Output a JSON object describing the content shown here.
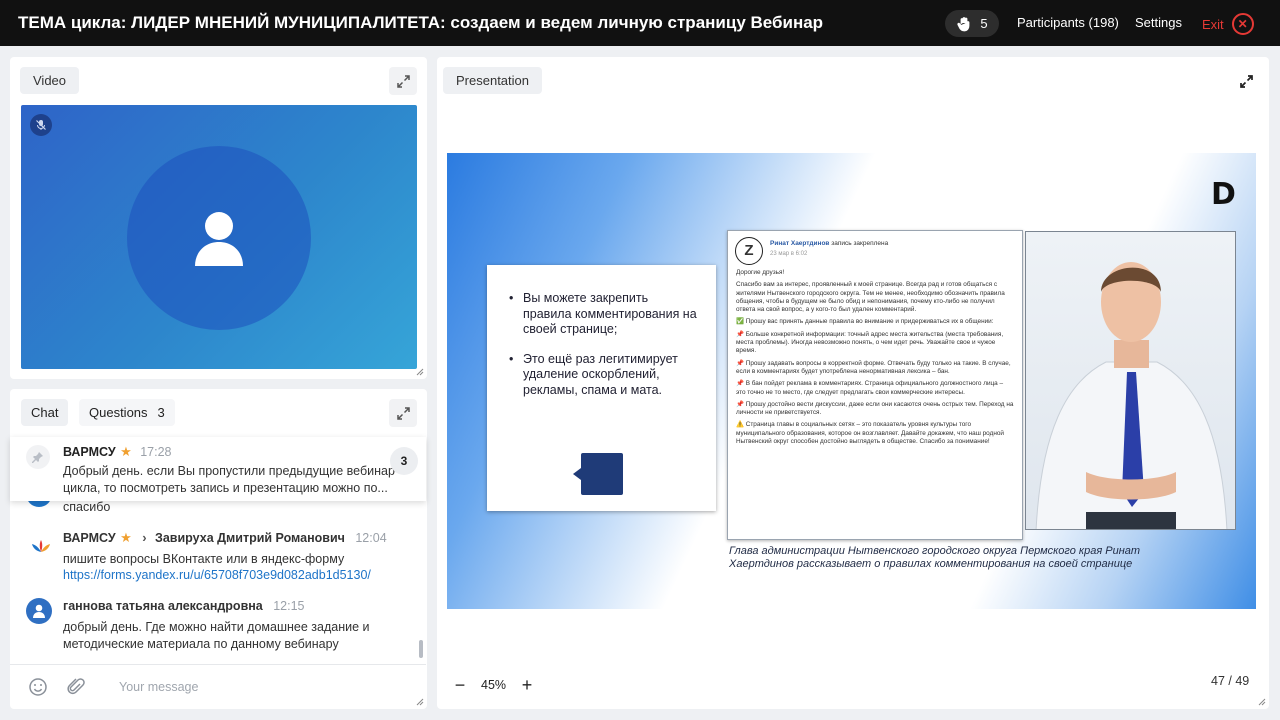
{
  "header": {
    "title": "ТЕМА цикла: ЛИДЕР МНЕНИЙ МУНИЦИПАЛИТЕТА: создаем и ведем личную страницу Вебинар",
    "raised_hands": "5",
    "participants": "Participants (198)",
    "settings": "Settings",
    "exit": "Exit"
  },
  "video": {
    "label": "Video"
  },
  "chat": {
    "tab_chat": "Chat",
    "tab_questions": "Questions",
    "questions_count": "3",
    "pinned": {
      "name": "ВАРМСУ",
      "star": "★",
      "time": "17:28",
      "line1": "Добрый день. если Вы пропустили предыдущие вебинар",
      "line2": "цикла, то посмотреть запись и презентацию можно по...",
      "badge": "3"
    },
    "messages": [
      {
        "text": "спасибо"
      },
      {
        "name": "ВАРМСУ",
        "star": "★",
        "arrow": "›",
        "to": "Завируха Дмитрий Романович",
        "time": "12:04",
        "line1": "пишите вопросы ВКонтакте или в яндекс-форму",
        "link": "https://forms.yandex.ru/u/65708f703e9d082adb1d5130/"
      },
      {
        "name": "ганнова татьяна александровна",
        "time": "12:15",
        "line1": "добрый день. Где можно найти домашнее задание и",
        "line2": "методические материала по данному вебинару"
      }
    ],
    "input_placeholder": "Your message"
  },
  "presentation": {
    "label": "Presentation",
    "zoom": "45%",
    "zoom_minus": "−",
    "zoom_plus": "+",
    "page": "47 / 49",
    "slide": {
      "logo": "D",
      "bullets": [
        "Вы можете закрепить правила комментирования на своей странице;",
        "Это ещё раз легитимирует удаление оскорблений, рекламы, спама и мата."
      ],
      "post_logo": "Z",
      "post_author": "Ринат Хаертдинов",
      "post_pinned": "запись закреплена",
      "post_date": "23 мар в 6:02",
      "post_paragraphs": [
        "Дорогие друзья!",
        "Спасибо вам за интерес, проявленный к моей странице. Всегда рад и готов общаться с жителями Нытвенского городского округа. Тем не менее, необходимо обозначить правила общения, чтобы в будущем не было обид и непонимания, почему кто-либо не получил ответа на свой вопрос, а у кого-то был удален комментарий.",
        "✅ Прошу вас принять данные правила во внимание и придерживаться их в общении:",
        "📌 Больше конкретной информации: точный адрес места жительства (места требования, места проблемы). Иногда невозможно понять, о чем идет речь. Уважайте свое и чужое время.",
        "📌 Прошу задавать вопросы в корректной форме. Отвечать буду только на такие. В случае, если в комментариях будет употреблена ненормативная лексика – бан.",
        "📌 В бан пойдет реклама в комментариях. Страница официального должностного лица – это точно не то место, где следует предлагать свои коммерческие интересы.",
        "📌 Прошу достойно вести дискуссии, даже если они касаются очень острых тем. Переход на личности не приветствуется.",
        "⚠️ Страница главы в социальных сетях – это показатель уровня культуры того муниципального образования, которое он возглавляет. Давайте докажем, что наш родной Нытвенский округ способен достойно выглядеть в обществе. Спасибо за понимание!"
      ],
      "caption": "Глава администрации Нытвенского городского округа Пермского края Ринат Хаертдинов рассказывает о правилах комментирования на своей странице"
    }
  },
  "colors": {
    "accent_blue": "#1e74c8",
    "exit_red": "#e53935",
    "star": "#f0a030"
  }
}
